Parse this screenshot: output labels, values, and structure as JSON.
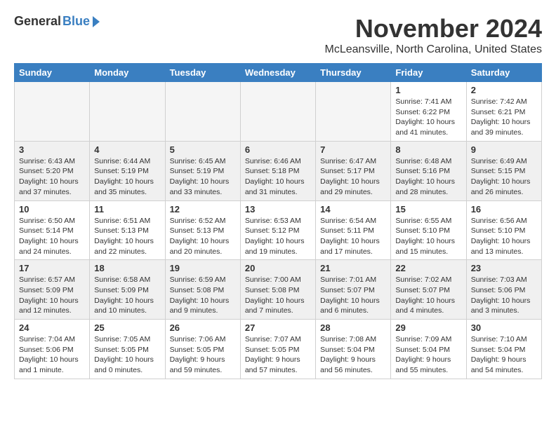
{
  "header": {
    "logo_general": "General",
    "logo_blue": "Blue",
    "month_title": "November 2024",
    "location": "McLeansville, North Carolina, United States"
  },
  "days_of_week": [
    "Sunday",
    "Monday",
    "Tuesday",
    "Wednesday",
    "Thursday",
    "Friday",
    "Saturday"
  ],
  "weeks": [
    [
      {
        "day": "",
        "info": "",
        "empty": true
      },
      {
        "day": "",
        "info": "",
        "empty": true
      },
      {
        "day": "",
        "info": "",
        "empty": true
      },
      {
        "day": "",
        "info": "",
        "empty": true
      },
      {
        "day": "",
        "info": "",
        "empty": true
      },
      {
        "day": "1",
        "info": "Sunrise: 7:41 AM\nSunset: 6:22 PM\nDaylight: 10 hours\nand 41 minutes."
      },
      {
        "day": "2",
        "info": "Sunrise: 7:42 AM\nSunset: 6:21 PM\nDaylight: 10 hours\nand 39 minutes."
      }
    ],
    [
      {
        "day": "3",
        "info": "Sunrise: 6:43 AM\nSunset: 5:20 PM\nDaylight: 10 hours\nand 37 minutes."
      },
      {
        "day": "4",
        "info": "Sunrise: 6:44 AM\nSunset: 5:19 PM\nDaylight: 10 hours\nand 35 minutes."
      },
      {
        "day": "5",
        "info": "Sunrise: 6:45 AM\nSunset: 5:19 PM\nDaylight: 10 hours\nand 33 minutes."
      },
      {
        "day": "6",
        "info": "Sunrise: 6:46 AM\nSunset: 5:18 PM\nDaylight: 10 hours\nand 31 minutes."
      },
      {
        "day": "7",
        "info": "Sunrise: 6:47 AM\nSunset: 5:17 PM\nDaylight: 10 hours\nand 29 minutes."
      },
      {
        "day": "8",
        "info": "Sunrise: 6:48 AM\nSunset: 5:16 PM\nDaylight: 10 hours\nand 28 minutes."
      },
      {
        "day": "9",
        "info": "Sunrise: 6:49 AM\nSunset: 5:15 PM\nDaylight: 10 hours\nand 26 minutes."
      }
    ],
    [
      {
        "day": "10",
        "info": "Sunrise: 6:50 AM\nSunset: 5:14 PM\nDaylight: 10 hours\nand 24 minutes."
      },
      {
        "day": "11",
        "info": "Sunrise: 6:51 AM\nSunset: 5:13 PM\nDaylight: 10 hours\nand 22 minutes."
      },
      {
        "day": "12",
        "info": "Sunrise: 6:52 AM\nSunset: 5:13 PM\nDaylight: 10 hours\nand 20 minutes."
      },
      {
        "day": "13",
        "info": "Sunrise: 6:53 AM\nSunset: 5:12 PM\nDaylight: 10 hours\nand 19 minutes."
      },
      {
        "day": "14",
        "info": "Sunrise: 6:54 AM\nSunset: 5:11 PM\nDaylight: 10 hours\nand 17 minutes."
      },
      {
        "day": "15",
        "info": "Sunrise: 6:55 AM\nSunset: 5:10 PM\nDaylight: 10 hours\nand 15 minutes."
      },
      {
        "day": "16",
        "info": "Sunrise: 6:56 AM\nSunset: 5:10 PM\nDaylight: 10 hours\nand 13 minutes."
      }
    ],
    [
      {
        "day": "17",
        "info": "Sunrise: 6:57 AM\nSunset: 5:09 PM\nDaylight: 10 hours\nand 12 minutes."
      },
      {
        "day": "18",
        "info": "Sunrise: 6:58 AM\nSunset: 5:09 PM\nDaylight: 10 hours\nand 10 minutes."
      },
      {
        "day": "19",
        "info": "Sunrise: 6:59 AM\nSunset: 5:08 PM\nDaylight: 10 hours\nand 9 minutes."
      },
      {
        "day": "20",
        "info": "Sunrise: 7:00 AM\nSunset: 5:08 PM\nDaylight: 10 hours\nand 7 minutes."
      },
      {
        "day": "21",
        "info": "Sunrise: 7:01 AM\nSunset: 5:07 PM\nDaylight: 10 hours\nand 6 minutes."
      },
      {
        "day": "22",
        "info": "Sunrise: 7:02 AM\nSunset: 5:07 PM\nDaylight: 10 hours\nand 4 minutes."
      },
      {
        "day": "23",
        "info": "Sunrise: 7:03 AM\nSunset: 5:06 PM\nDaylight: 10 hours\nand 3 minutes."
      }
    ],
    [
      {
        "day": "24",
        "info": "Sunrise: 7:04 AM\nSunset: 5:06 PM\nDaylight: 10 hours\nand 1 minute."
      },
      {
        "day": "25",
        "info": "Sunrise: 7:05 AM\nSunset: 5:05 PM\nDaylight: 10 hours\nand 0 minutes."
      },
      {
        "day": "26",
        "info": "Sunrise: 7:06 AM\nSunset: 5:05 PM\nDaylight: 9 hours\nand 59 minutes."
      },
      {
        "day": "27",
        "info": "Sunrise: 7:07 AM\nSunset: 5:05 PM\nDaylight: 9 hours\nand 57 minutes."
      },
      {
        "day": "28",
        "info": "Sunrise: 7:08 AM\nSunset: 5:04 PM\nDaylight: 9 hours\nand 56 minutes."
      },
      {
        "day": "29",
        "info": "Sunrise: 7:09 AM\nSunset: 5:04 PM\nDaylight: 9 hours\nand 55 minutes."
      },
      {
        "day": "30",
        "info": "Sunrise: 7:10 AM\nSunset: 5:04 PM\nDaylight: 9 hours\nand 54 minutes."
      }
    ]
  ]
}
